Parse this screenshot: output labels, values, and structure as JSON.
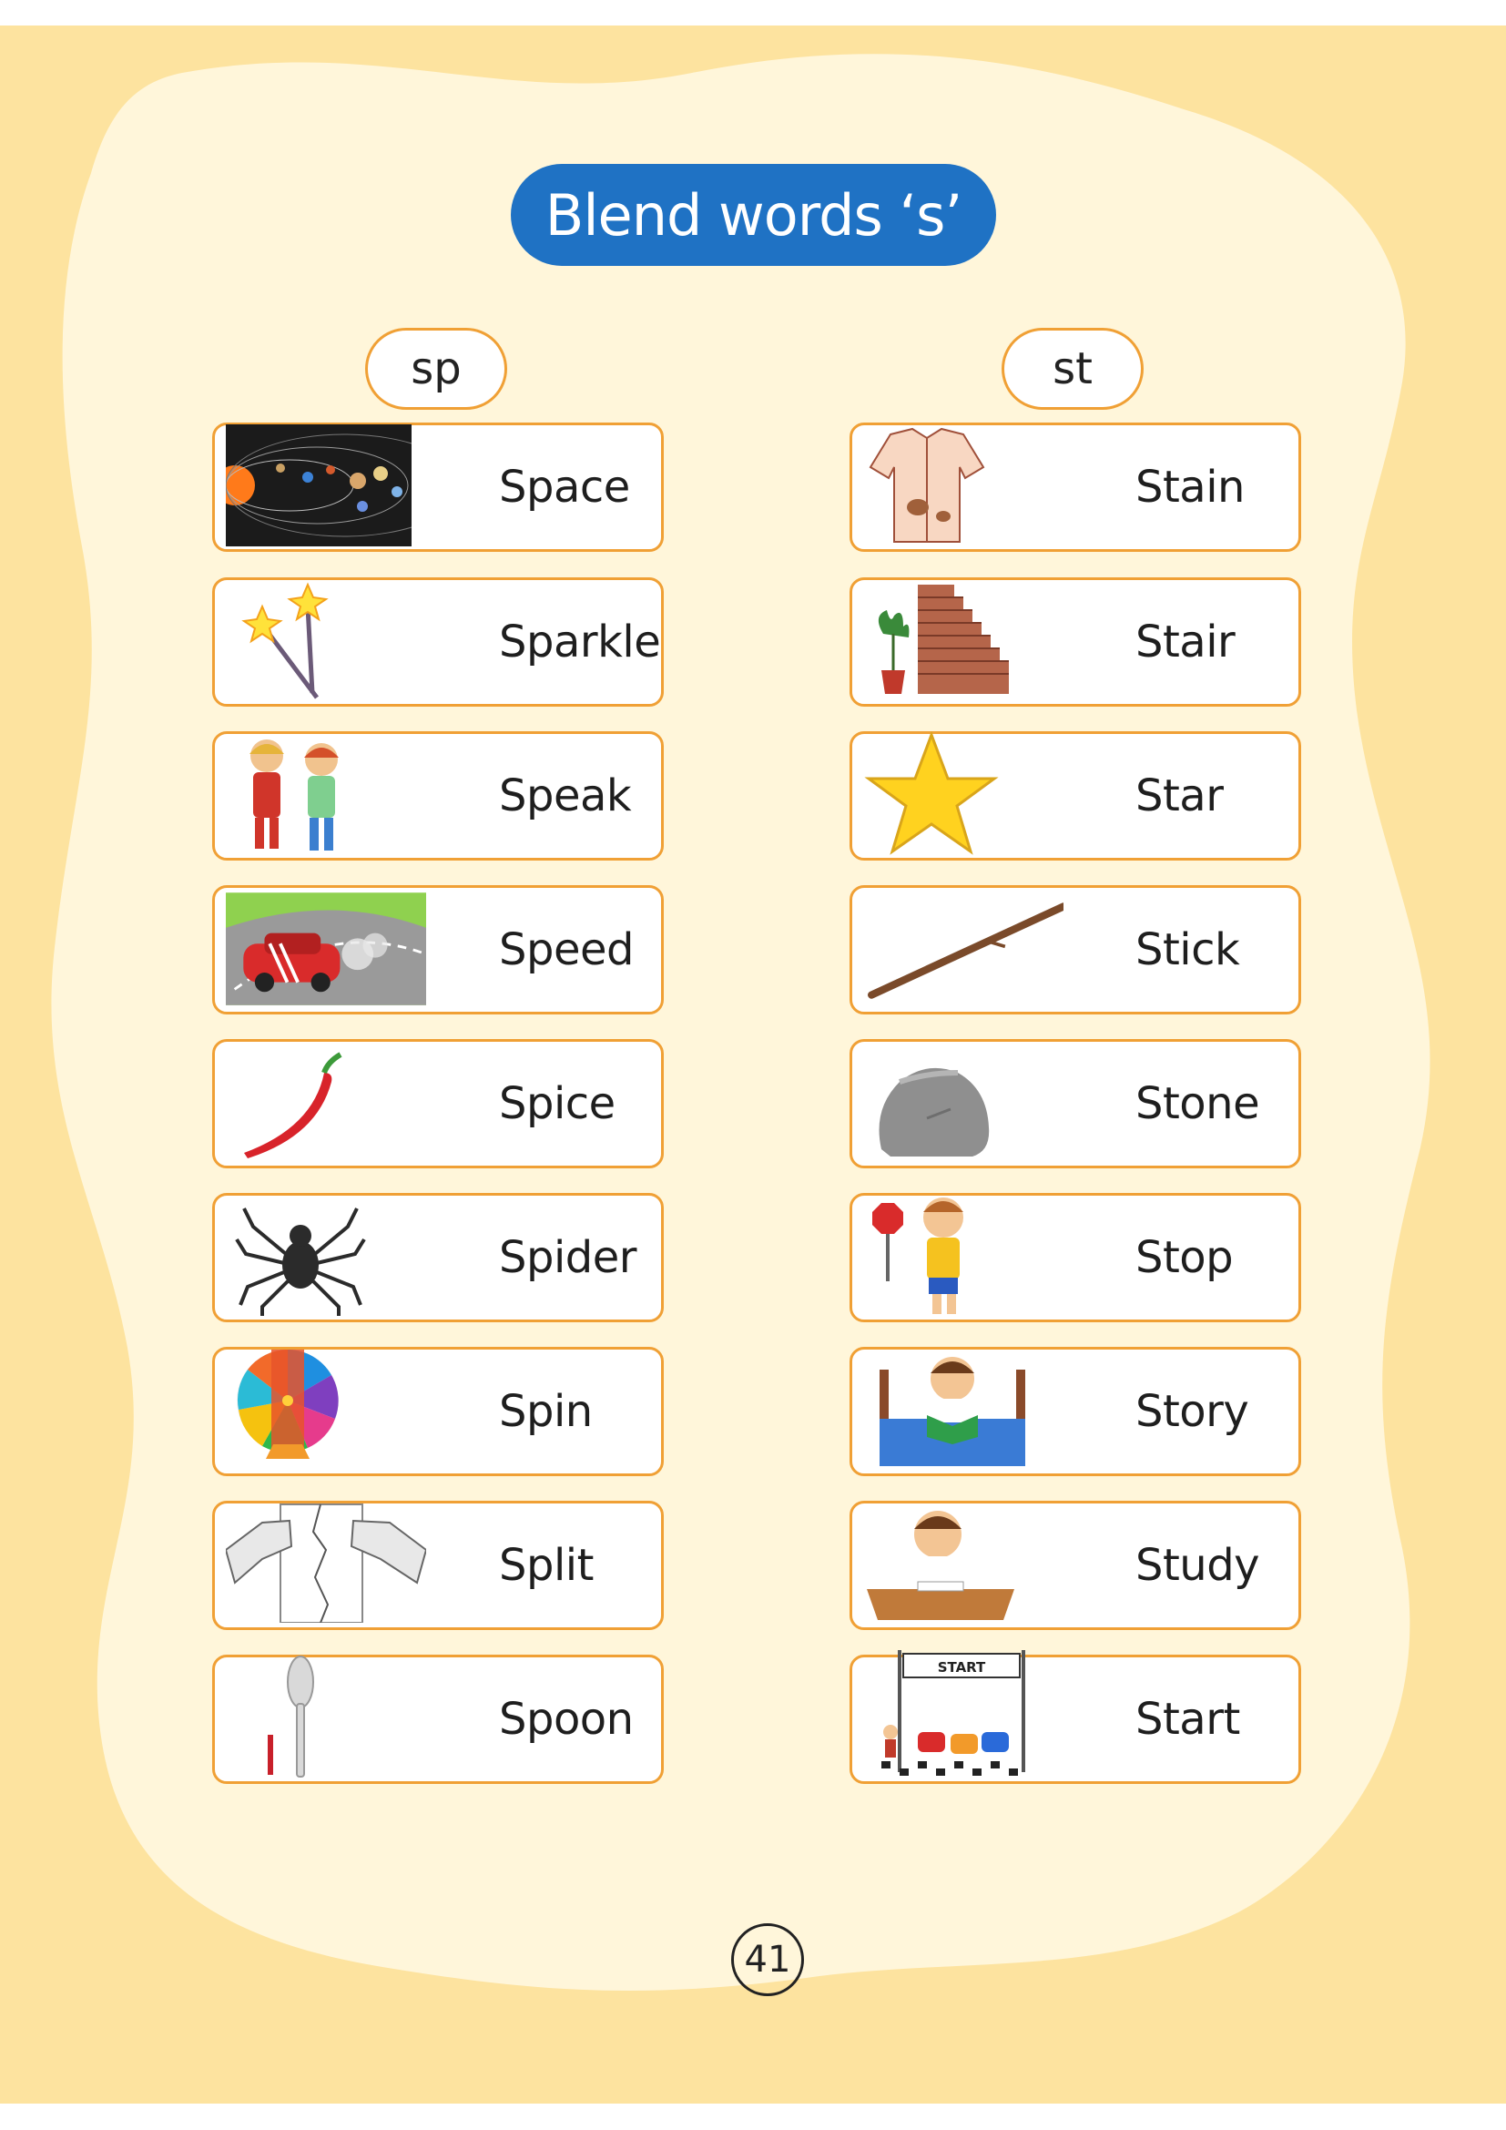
{
  "title": "Blend words ‘s’",
  "columns": [
    {
      "heading": "sp",
      "words": [
        {
          "label": "Space",
          "icon": "solar-system-icon"
        },
        {
          "label": "Sparkle",
          "icon": "sparkler-icon"
        },
        {
          "label": "Speak",
          "icon": "kids-talking-icon"
        },
        {
          "label": "Speed",
          "icon": "racing-car-icon"
        },
        {
          "label": "Spice",
          "icon": "chili-pepper-icon"
        },
        {
          "label": "Spider",
          "icon": "spider-icon"
        },
        {
          "label": "Spin",
          "icon": "prize-wheel-icon"
        },
        {
          "label": "Split",
          "icon": "torn-paper-icon"
        },
        {
          "label": "Spoon",
          "icon": "spoon-icon"
        }
      ]
    },
    {
      "heading": "st",
      "words": [
        {
          "label": "Stain",
          "icon": "stained-shirt-icon"
        },
        {
          "label": "Stair",
          "icon": "staircase-icon"
        },
        {
          "label": "Star",
          "icon": "star-icon"
        },
        {
          "label": "Stick",
          "icon": "stick-icon"
        },
        {
          "label": "Stone",
          "icon": "stone-icon"
        },
        {
          "label": "Stop",
          "icon": "boy-stop-sign-icon"
        },
        {
          "label": "Story",
          "icon": "boy-reading-icon"
        },
        {
          "label": "Study",
          "icon": "boy-studying-icon"
        },
        {
          "label": "Start",
          "icon": "race-start-icon"
        }
      ]
    }
  ],
  "page_number": "41",
  "colors": {
    "background": "#fde39f",
    "inner_panel": "#fff6da",
    "title_pill": "#1f72c4",
    "card_border": "#f0a035"
  }
}
